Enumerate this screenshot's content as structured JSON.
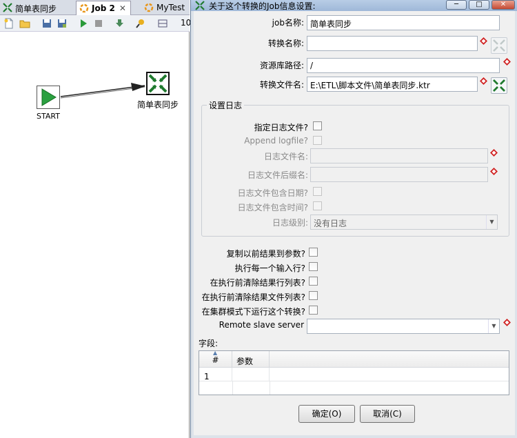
{
  "editor": {
    "tabs": [
      {
        "label": "简单表同步"
      },
      {
        "label": "Job 2",
        "close": "✕"
      },
      {
        "label": "MyTest"
      }
    ],
    "zoom_partial": "10",
    "nodes": {
      "start_label": "START",
      "transform_label": "简单表同步"
    }
  },
  "dialog": {
    "title": "关于这个转换的Job信息设置:",
    "window_buttons": {
      "minimize": "─",
      "maximize": "□",
      "close": "✕"
    },
    "fields": {
      "job_name_label": "job名称:",
      "job_name_value": "简单表同步",
      "transform_name_label": "转换名称:",
      "transform_name_value": "",
      "repo_path_label": "资源库路径:",
      "repo_path_value": "/",
      "transform_file_label": "转换文件名:",
      "transform_file_value": "E:\\ETL\\脚本文件\\简单表同步.ktr"
    },
    "log_group": {
      "title": "设置日志",
      "specify_log_file": "指定日志文件?",
      "append_logfile": "Append logfile?",
      "log_file_name": "日志文件名:",
      "log_file_ext": "日志文件后缀名:",
      "include_date": "日志文件包含日期?",
      "include_time": "日志文件包含时间?",
      "log_level_label": "日志级别:",
      "log_level_value": "没有日志"
    },
    "options": {
      "copy_prev_results": "复制以前结果到参数?",
      "exec_each_row": "执行每一个输入行?",
      "clear_result_rows": "在执行前清除结果行列表?",
      "clear_result_files": "在执行前清除结果文件列表?",
      "cluster_mode": "在集群模式下运行这个转换?",
      "remote_slave_label": "Remote slave server",
      "remote_slave_value": ""
    },
    "fields_section": {
      "label": "字段:",
      "columns": [
        "#",
        "参数"
      ],
      "rows": [
        [
          "1",
          ""
        ]
      ]
    },
    "buttons": {
      "ok": "确定(O)",
      "cancel": "取消(C)"
    }
  }
}
